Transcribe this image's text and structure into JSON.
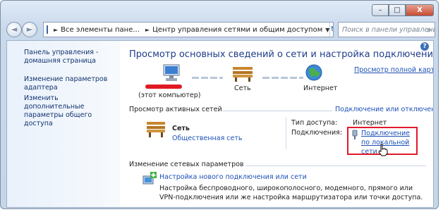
{
  "window": {
    "buttons": {
      "minimize": "–",
      "maximize": "□",
      "close": "X"
    }
  },
  "nav": {
    "back": "◄",
    "forward": "►",
    "breadcrumbs": [
      "Все элементы пане...",
      "Центр управления сетями и общим доступом"
    ],
    "search_placeholder": "Поиск в панели управления"
  },
  "sidebar": {
    "items": [
      {
        "label": "Панель управления - домашняя страница"
      },
      {
        "label": "Изменение параметров адаптера"
      },
      {
        "label": "Изменить дополнительные параметры общего доступа"
      }
    ]
  },
  "main": {
    "title": "Просмотр основных сведений о сети и настройка подключений",
    "full_map_link": "Просмотр полной карты",
    "map": {
      "computer_label": "(этот компьютер)",
      "network_label": "Сеть",
      "internet_label": "Интернет"
    },
    "active_networks": {
      "header": "Просмотр активных сетей",
      "connect_link": "Подключение или отключение",
      "network_name": "Сеть",
      "network_type": "Общественная сеть",
      "access_type_label": "Тип доступа:",
      "access_type_value": "Интернет",
      "connections_label": "Подключения:",
      "connection_link": "Подключение по локальной сети"
    },
    "change_settings": {
      "header": "Изменение сетевых параметров",
      "item_title": "Настройка нового подключения или сети",
      "item_desc_1": "Настройка беспроводного, широкополосного, модемного, прямого или",
      "item_desc_2": "VPN-подключения или же настройка маршрутизатора или точки доступа."
    }
  },
  "colors": {
    "highlight": "#e2192b",
    "link": "#1b4fb5",
    "title": "#1e3c8a"
  }
}
